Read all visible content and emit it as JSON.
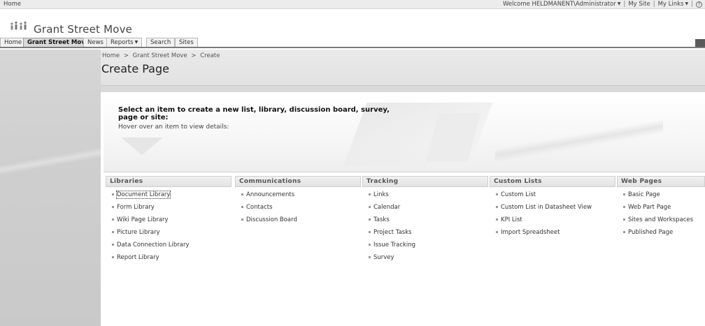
{
  "global": {
    "home": "Home",
    "welcome": "Welcome HELDMANENT\\Administrator",
    "my_site": "My Site",
    "my_links": "My Links"
  },
  "site": {
    "title": "Grant Street Move"
  },
  "tabs": [
    {
      "label": "Home"
    },
    {
      "label": "Grant Street Move",
      "selected": true
    },
    {
      "label": "News"
    },
    {
      "label": "Reports"
    },
    {
      "label": "Search"
    },
    {
      "label": "Sites"
    }
  ],
  "breadcrumb": [
    "Home",
    ">",
    "Grant Street Move",
    ">",
    "Create"
  ],
  "page_title": "Create Page",
  "intro": {
    "heading": "Select an item to create a new list, library, discussion board, survey, page or site:",
    "hint": "Hover over an item to view details:"
  },
  "columns": [
    {
      "title": "Libraries",
      "items": [
        "Document Library",
        "Form Library",
        "Wiki Page Library",
        "Picture Library",
        "Data Connection Library",
        "Report Library"
      ]
    },
    {
      "title": "Communications",
      "items": [
        "Announcements",
        "Contacts",
        "Discussion Board"
      ]
    },
    {
      "title": "Tracking",
      "items": [
        "Links",
        "Calendar",
        "Tasks",
        "Project Tasks",
        "Issue Tracking",
        "Survey"
      ]
    },
    {
      "title": "Custom Lists",
      "items": [
        "Custom List",
        "Custom List in Datasheet View",
        "KPI List",
        "Import Spreadsheet"
      ]
    },
    {
      "title": "Web Pages",
      "items": [
        "Basic Page",
        "Web Part Page",
        "Sites and Workspaces",
        "Published Page"
      ]
    }
  ],
  "icons": {
    "site_logo": "people-group-icon",
    "help": "help-icon",
    "dropdown": "chevron-down-icon"
  }
}
